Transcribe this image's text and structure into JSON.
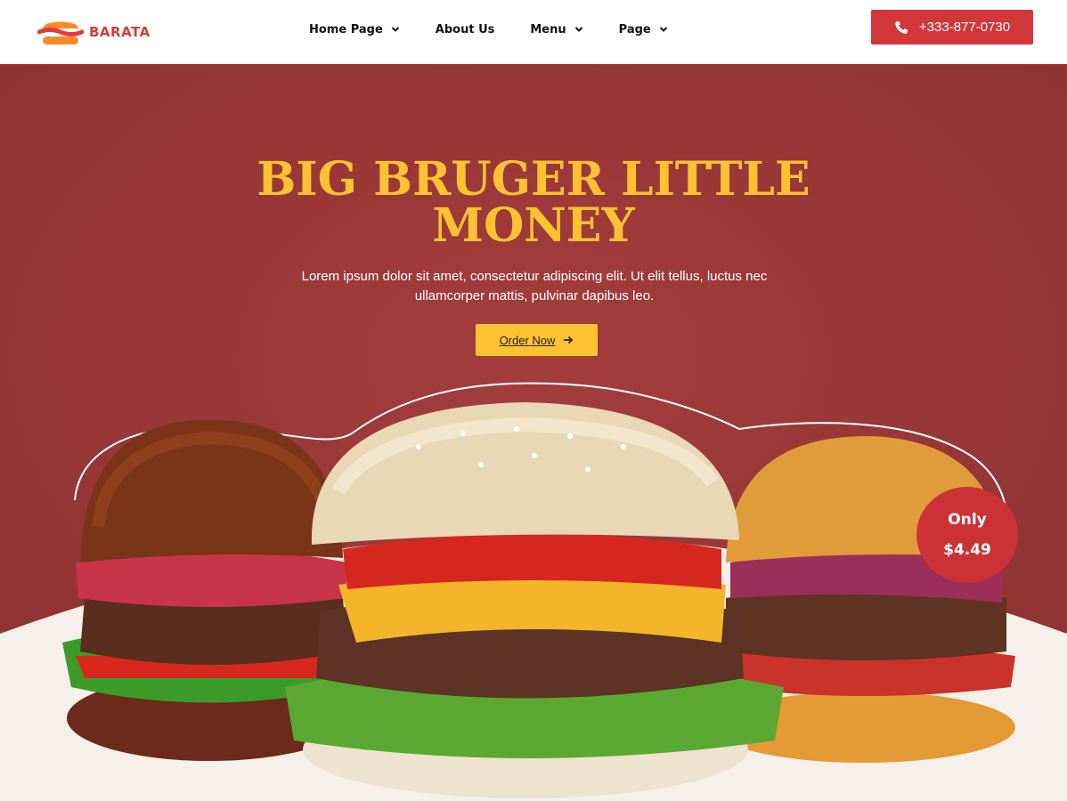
{
  "brand": {
    "name": "BARATA"
  },
  "nav": {
    "items": [
      {
        "label": "Home Page",
        "has_dropdown": true
      },
      {
        "label": "About Us",
        "has_dropdown": false
      },
      {
        "label": "Menu",
        "has_dropdown": true
      },
      {
        "label": "Page",
        "has_dropdown": true
      }
    ]
  },
  "contact": {
    "phone": "+333-877-0730",
    "icon": "phone-icon"
  },
  "hero": {
    "title_line1": "BIG BRUGER LITTLE",
    "title_line2": "MONEY",
    "description_line1": "Lorem ipsum dolor sit amet, consectetur adipiscing elit. Ut elit tellus, luctus nec",
    "description_line2": "ullamcorper mattis, pulvinar dapibus leo.",
    "cta_label": "Order Now",
    "cta_icon": "arrow-right-icon"
  },
  "price_badge": {
    "line1": "Only",
    "line2": "$4.49"
  },
  "colors": {
    "brand_red": "#d13638",
    "hero_bg": "#9a3838",
    "accent_yellow": "#fdc232",
    "page_bg": "#f5f0ea"
  }
}
